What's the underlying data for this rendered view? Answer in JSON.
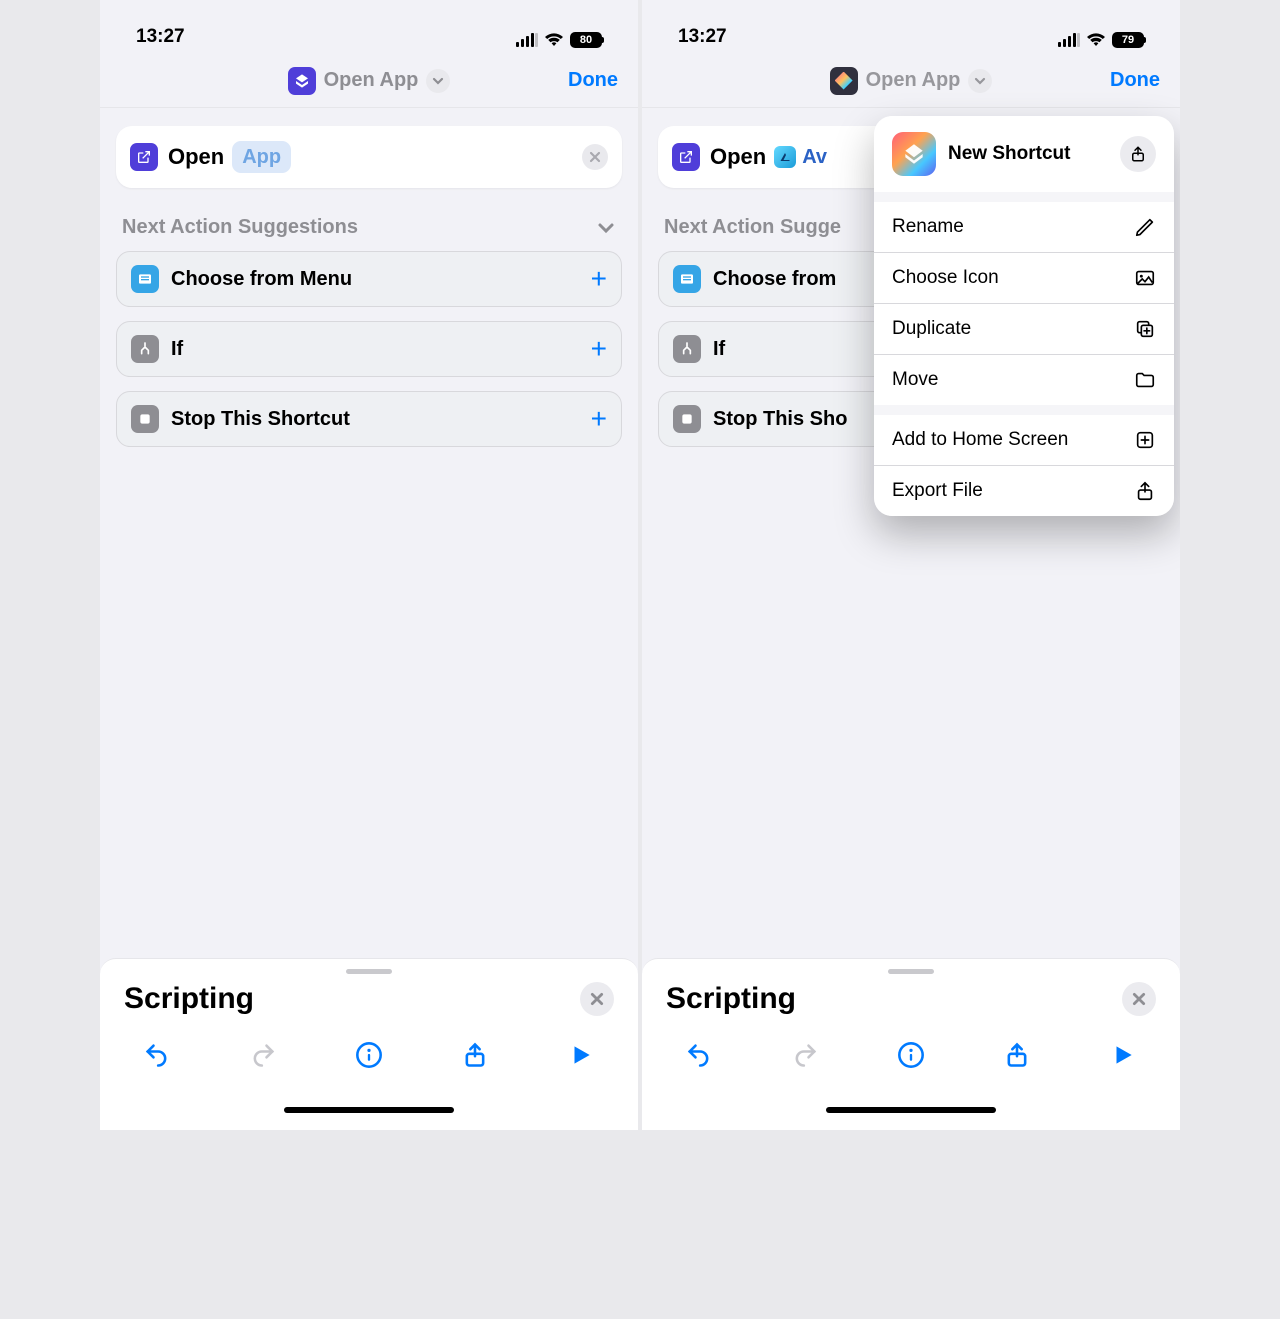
{
  "left": {
    "status": {
      "time": "13:27",
      "battery": "80"
    },
    "header": {
      "icon_color": "#4f3ed9",
      "title": "Open App",
      "done": "Done"
    },
    "action": {
      "verb": "Open",
      "param": "App"
    },
    "suggest_title": "Next Action Suggestions",
    "suggestions": [
      {
        "label": "Choose from Menu",
        "icon": "choose-menu",
        "icon_bg": "#35a5e6"
      },
      {
        "label": "If",
        "icon": "if",
        "icon_bg": "#8e8e93"
      },
      {
        "label": "Stop This Shortcut",
        "icon": "stop",
        "icon_bg": "#8e8e93"
      }
    ],
    "drawer_title": "Scripting"
  },
  "right": {
    "status": {
      "time": "13:27",
      "battery": "79"
    },
    "header": {
      "title": "Open App",
      "done": "Done"
    },
    "action": {
      "verb": "Open",
      "param": "Av"
    },
    "suggest_title": "Next Action Sugge",
    "suggestions": [
      {
        "label": "Choose from",
        "icon": "choose-menu",
        "icon_bg": "#35a5e6"
      },
      {
        "label": "If",
        "icon": "if",
        "icon_bg": "#8e8e93"
      },
      {
        "label": "Stop This Sho",
        "icon": "stop",
        "icon_bg": "#8e8e93"
      }
    ],
    "drawer_title": "Scripting",
    "popover": {
      "title": "New Shortcut",
      "groups": [
        [
          {
            "label": "Rename",
            "icon": "pencil"
          },
          {
            "label": "Choose Icon",
            "icon": "photo"
          },
          {
            "label": "Duplicate",
            "icon": "duplicate"
          },
          {
            "label": "Move",
            "icon": "folder"
          }
        ],
        [
          {
            "label": "Add to Home Screen",
            "icon": "plus-box"
          },
          {
            "label": "Export File",
            "icon": "share-up"
          }
        ]
      ]
    }
  }
}
